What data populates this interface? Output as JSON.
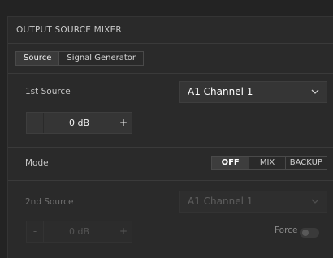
{
  "panel": {
    "title": "OUTPUT SOURCE MIXER",
    "tabs": [
      {
        "label": "Source",
        "active": true
      },
      {
        "label": "Signal Generator",
        "active": false
      }
    ]
  },
  "source1": {
    "label": "1st Source",
    "selected": "A1 Channel 1",
    "gain": "0 dB",
    "minus": "-",
    "plus": "+"
  },
  "mode": {
    "label": "Mode",
    "options": [
      {
        "label": "OFF",
        "active": true
      },
      {
        "label": "MIX",
        "active": false
      },
      {
        "label": "BACKUP",
        "active": false
      }
    ]
  },
  "source2": {
    "label": "2nd Source",
    "selected": "A1 Channel 1",
    "gain": "0 dB",
    "minus": "-",
    "plus": "+",
    "force_label": "Force",
    "force_on": false
  },
  "colors": {
    "background": "#232323",
    "panel": "#2a2a2a",
    "control": "#353535",
    "text": "#d8d8d8",
    "disabled_text": "#5f5f5f"
  }
}
